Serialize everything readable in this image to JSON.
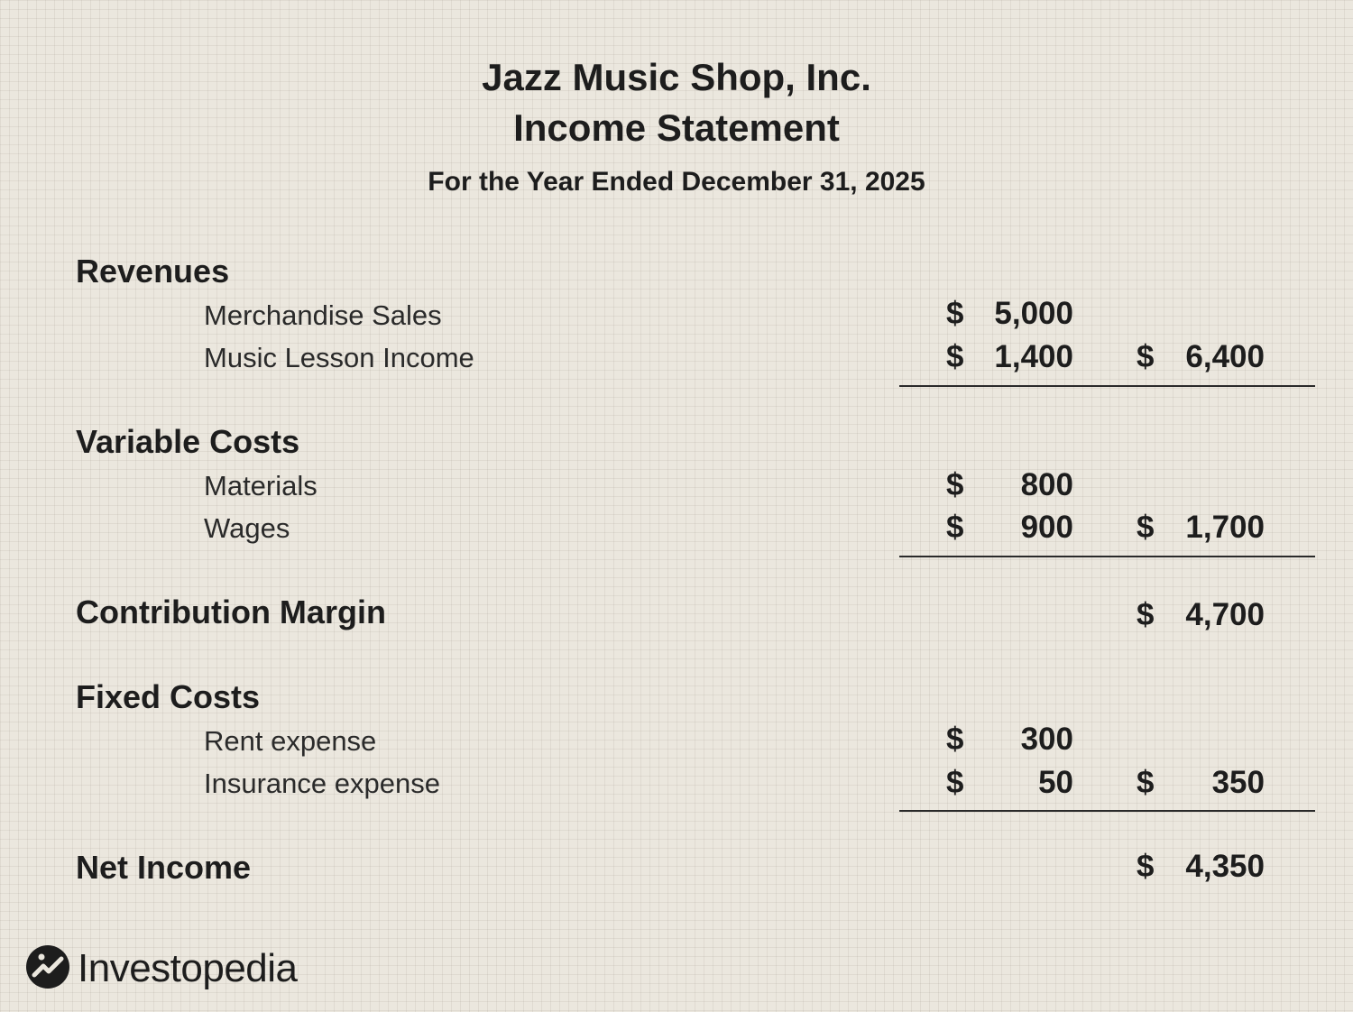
{
  "header": {
    "company": "Jazz Music Shop, Inc.",
    "statement": "Income Statement",
    "period": "For the Year Ended December 31, 2025"
  },
  "revenues": {
    "heading": "Revenues",
    "items": [
      {
        "label": "Merchandise Sales",
        "currency": "$",
        "amount": "5,000"
      },
      {
        "label": "Music Lesson Income",
        "currency": "$",
        "amount": "1,400"
      }
    ],
    "total_currency": "$",
    "total": "6,400"
  },
  "variable_costs": {
    "heading": "Variable Costs",
    "items": [
      {
        "label": "Materials",
        "currency": "$",
        "amount": "800"
      },
      {
        "label": "Wages",
        "currency": "$",
        "amount": "900"
      }
    ],
    "total_currency": "$",
    "total": "1,700"
  },
  "contribution_margin": {
    "heading": "Contribution Margin",
    "currency": "$",
    "total": "4,700"
  },
  "fixed_costs": {
    "heading": "Fixed Costs",
    "items": [
      {
        "label": "Rent expense",
        "currency": "$",
        "amount": "300"
      },
      {
        "label": "Insurance expense",
        "currency": "$",
        "amount": "50"
      }
    ],
    "total_currency": "$",
    "total": "350"
  },
  "net_income": {
    "heading": "Net Income",
    "currency": "$",
    "total": "4,350"
  },
  "brand": {
    "name": "Investopedia",
    "icon": "investopedia-logo-icon"
  },
  "colors": {
    "background": "#ebe7de",
    "text": "#1d1d1d"
  }
}
